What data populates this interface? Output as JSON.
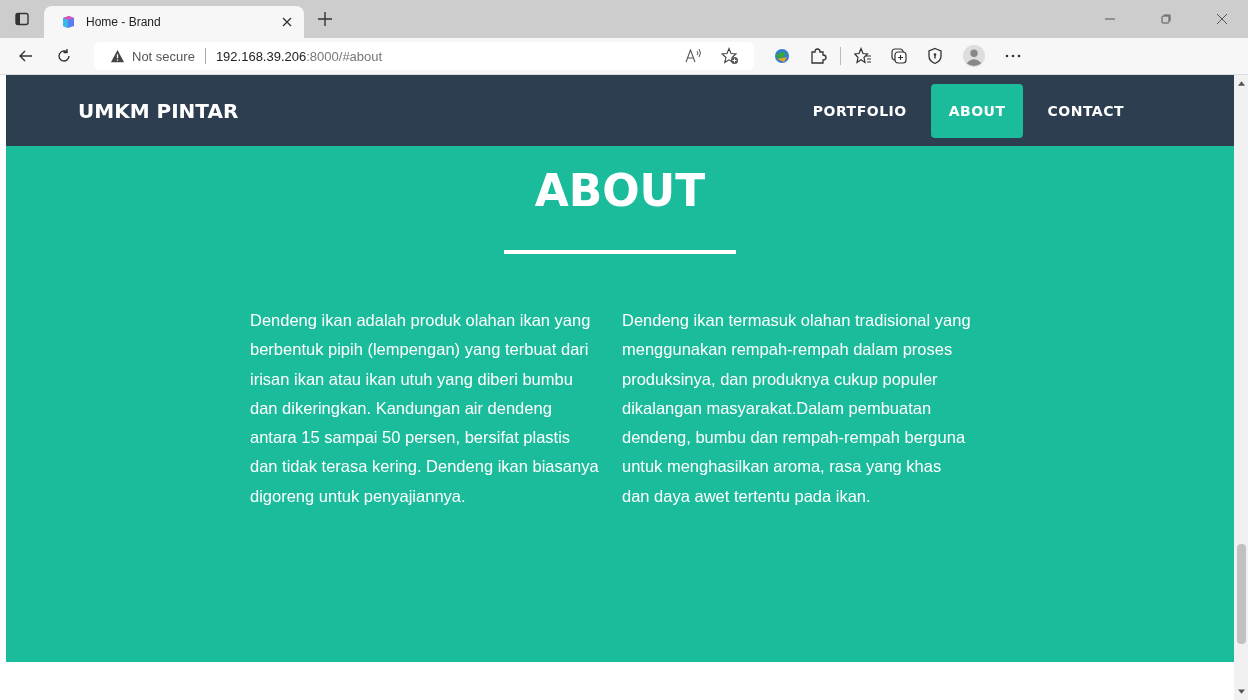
{
  "browser": {
    "tab_title": "Home - Brand",
    "security": "Not secure",
    "url_host": "192.168.39.206",
    "url_rest": ":8000/#about"
  },
  "navbar": {
    "brand": "UMKM PINTAR",
    "items": [
      {
        "label": "PORTFOLIO",
        "selected": false
      },
      {
        "label": "ABOUT",
        "selected": true
      },
      {
        "label": "CONTACT",
        "selected": false
      }
    ]
  },
  "section": {
    "title": "ABOUT",
    "paragraphs": [
      "Dendeng ikan adalah produk olahan ikan yang berbentuk pipih (lempengan) yang terbuat dari irisan ikan atau ikan utuh yang diberi bumbu dan dikeringkan. Kandungan air dendeng antara 15 sampai 50 persen, bersifat plastis dan tidak terasa kering. Dendeng ikan biasanya digoreng untuk penyajiannya.",
      "Dendeng ikan termasuk olahan tradisional yang menggunakan rempah-rempah dalam proses produksinya, dan produknya cukup populer dikalangan masyarakat.Dalam pembuatan dendeng, bumbu dan rempah-rempah berguna untuk menghasilkan aroma, rasa yang khas dan daya awet tertentu pada ikan."
    ]
  }
}
